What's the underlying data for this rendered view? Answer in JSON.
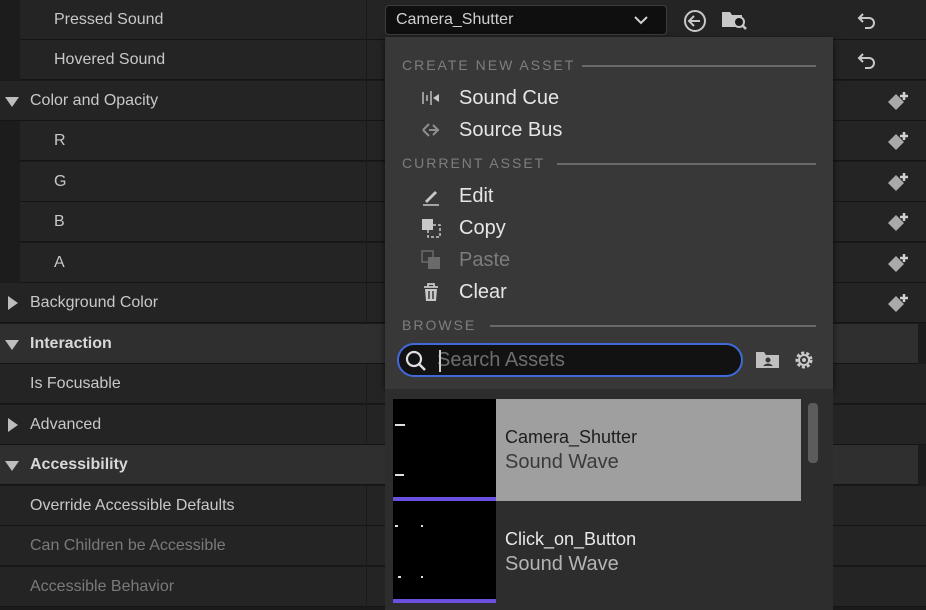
{
  "details": {
    "rows": [
      {
        "label": "Pressed Sound",
        "kind": "sub"
      },
      {
        "label": "Hovered Sound",
        "kind": "sub"
      },
      {
        "label": "Color and Opacity",
        "kind": "group",
        "expanded": true
      },
      {
        "label": "R",
        "kind": "sub"
      },
      {
        "label": "G",
        "kind": "sub"
      },
      {
        "label": "B",
        "kind": "sub"
      },
      {
        "label": "A",
        "kind": "sub"
      },
      {
        "label": "Background Color",
        "kind": "group",
        "expanded": false
      },
      {
        "label": "Interaction",
        "kind": "category",
        "expanded": true
      },
      {
        "label": "Is Focusable",
        "kind": "prop"
      },
      {
        "label": "Advanced",
        "kind": "group",
        "expanded": false
      },
      {
        "label": "Accessibility",
        "kind": "category",
        "expanded": true
      },
      {
        "label": "Override Accessible Defaults",
        "kind": "prop"
      },
      {
        "label": "Can Children be Accessible",
        "kind": "prop",
        "disabled": true
      },
      {
        "label": "Accessible Behavior",
        "kind": "prop",
        "disabled": true
      }
    ]
  },
  "combo": {
    "value": "Camera_Shutter",
    "icons": [
      "chevron-down-icon",
      "use-selected-icon",
      "browse-asset-icon"
    ]
  },
  "menu": {
    "create_header": "CREATE NEW ASSET",
    "sound_cue": "Sound Cue",
    "source_bus": "Source Bus",
    "current_header": "CURRENT ASSET",
    "edit": "Edit",
    "copy": "Copy",
    "paste": "Paste",
    "clear": "Clear",
    "browse_header": "BROWSE",
    "search_placeholder": "Search Assets"
  },
  "assets": [
    {
      "name": "Camera_Shutter",
      "type": "Sound Wave",
      "selected": true
    },
    {
      "name": "Click_on_Button",
      "type": "Sound Wave",
      "selected": false
    }
  ],
  "colors": {
    "accent": "#3f6ad8",
    "sound_wave_bar": "#6a4fe0",
    "selected_row": "#9f9f9f"
  }
}
